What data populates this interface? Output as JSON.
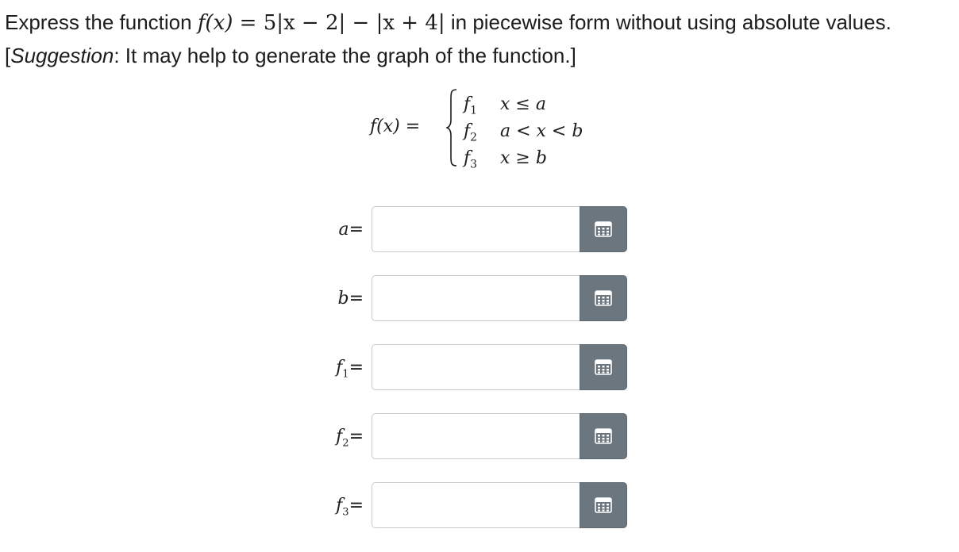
{
  "prompt": {
    "line1_prefix": "Express the function ",
    "function_lhs": "f(x)",
    "function_rhs": "= 5|x − 2| − |x + 4|",
    "line1_suffix": " in piecewise form without using absolute values.",
    "line2_open": "[",
    "suggestion_label": "Suggestion",
    "line2_rest": ": It may help to generate the graph of the function.]"
  },
  "piecewise": {
    "lhs": "f(x) =",
    "rows": [
      {
        "fn": "f",
        "sub": "1",
        "cond": "x ≤ a"
      },
      {
        "fn": "f",
        "sub": "2",
        "cond": "a < x < b"
      },
      {
        "fn": "f",
        "sub": "3",
        "cond": "x ≥ b"
      }
    ]
  },
  "answers": [
    {
      "var": "a",
      "sub": "",
      "eq": "=",
      "value": "",
      "keypad_icon": "keypad-grid-icon"
    },
    {
      "var": "b",
      "sub": "",
      "eq": "=",
      "value": "",
      "keypad_icon": "keypad-grid-icon"
    },
    {
      "var": "f",
      "sub": "1",
      "eq": "=",
      "value": "",
      "keypad_icon": "keypad-grid-icon"
    },
    {
      "var": "f",
      "sub": "2",
      "eq": "=",
      "value": "",
      "keypad_icon": "keypad-grid-icon"
    },
    {
      "var": "f",
      "sub": "3",
      "eq": "=",
      "value": "",
      "keypad_icon": "keypad-grid-icon"
    }
  ],
  "colors": {
    "text": "#1d1d1f",
    "input_border": "#c9c9c9",
    "keypad_button": "#6b767f",
    "keypad_icon": "#ffffff"
  }
}
